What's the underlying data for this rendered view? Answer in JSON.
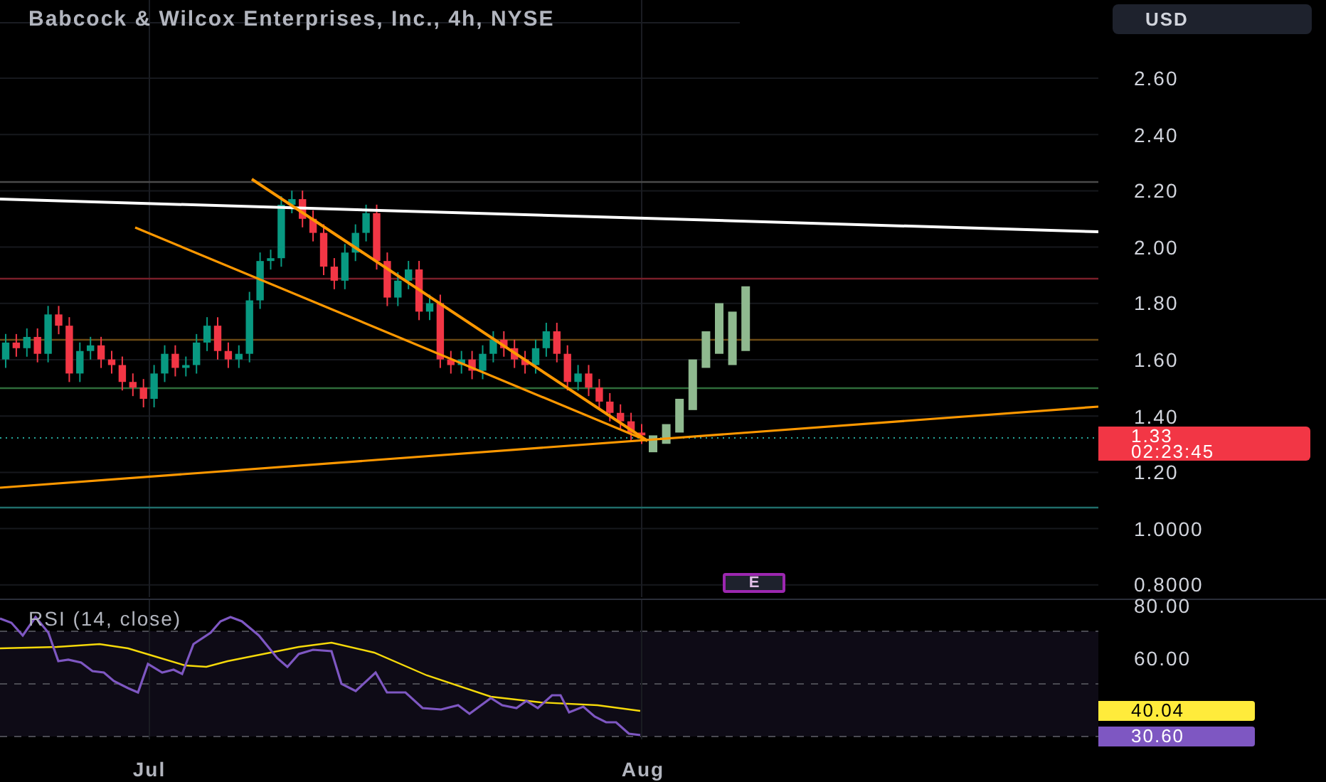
{
  "title": "Babcock & Wilcox Enterprises, Inc., 4h, NYSE",
  "currency_button": "USD",
  "price_axis": [
    "2.60",
    "2.40",
    "2.20",
    "2.00",
    "1.80",
    "1.60",
    "1.40",
    "1.20",
    "1.0000",
    "0.8000"
  ],
  "last_price": {
    "price": "1.33",
    "countdown": "02:23:45"
  },
  "earnings_marker": "E",
  "rsi": {
    "title": "RSI (14, close)",
    "axis_labels": [
      "80.00",
      "60.00"
    ],
    "ma_value": "40.04",
    "rsi_value": "30.60"
  },
  "time_axis": [
    "Jul",
    "Aug"
  ]
}
